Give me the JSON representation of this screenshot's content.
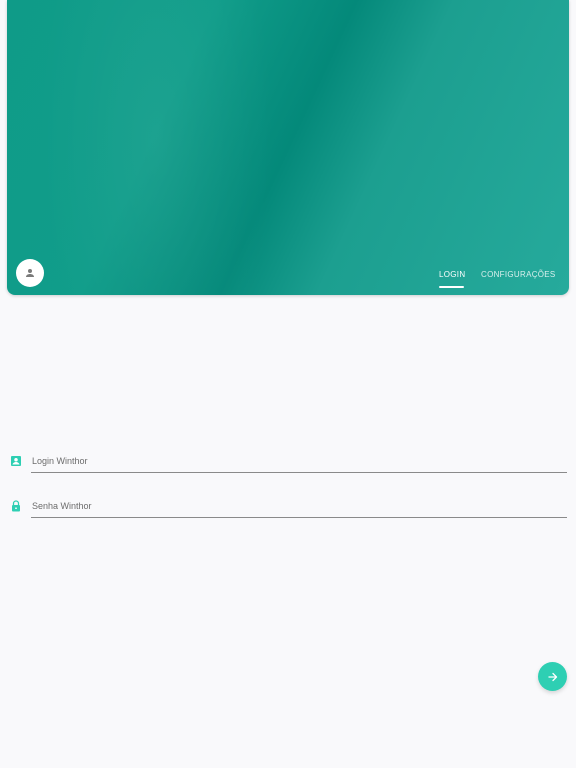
{
  "header": {
    "avatar_icon": "person-icon",
    "tabs": [
      {
        "label": "LOGIN",
        "active": true
      },
      {
        "label": "CONFIGURAÇÕES",
        "active": false
      }
    ]
  },
  "form": {
    "login": {
      "placeholder": "Login Winthor",
      "value": "",
      "icon": "account-box-icon"
    },
    "password": {
      "placeholder": "Senha Winthor",
      "value": "",
      "icon": "lock-icon"
    }
  },
  "submit": {
    "icon": "arrow-right-icon"
  },
  "colors": {
    "accent": "#2ecfb3",
    "header_primary": "#0a9280",
    "background": "#f9f9fb"
  }
}
